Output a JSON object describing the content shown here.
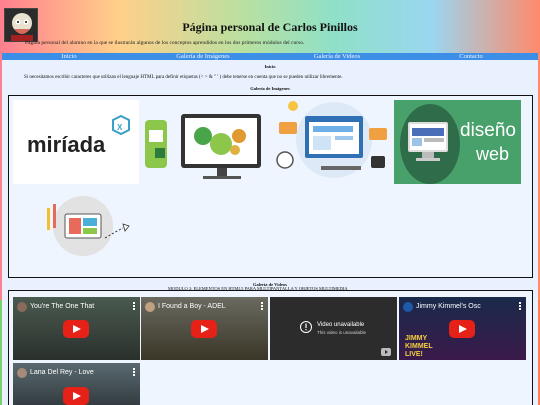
{
  "header": {
    "title": "Página personal de Carlos Pinillos",
    "intro": "Página personal del alumno en la que se ilustrarán algunos de los conceptos aprendidos en los dos primeros módulos del curso."
  },
  "nav": [
    "Inicio",
    "Galería de Imágenes",
    "Galería de Videos",
    "Contacto"
  ],
  "inicio": {
    "title": "Inicio",
    "text": "Si necesitamos escribir caracteres que utilizan el lenguaje HTML para definir etiquetas (< > & \"  ' ) debe tenerse en cuenta que no se pueden utilizar libremente."
  },
  "gallery_images": {
    "title": "Galería de Imágenes",
    "logo_miriada": "miríada",
    "logo_diseno": "diseño",
    "logo_web": "web"
  },
  "gallery_videos": {
    "title": "Galería de Videos",
    "overlay": "MODULO 2: ELEMENTOS EN HTML5 PARA MULTIPANTALLA Y OBJETOS MULTIMEDIA",
    "videos": [
      {
        "title": "You're The One That"
      },
      {
        "title": "I Found a Boy - ADEL"
      },
      {
        "title": "",
        "unavailable": "Video unavailable",
        "unavailable_sub": "This video is unavailable"
      },
      {
        "title": "Jimmy Kimmel's Osc"
      },
      {
        "title": "Lana Del Rey - Love"
      }
    ],
    "jimmy_caption": "JIMMY KIMMEL LIVE!"
  },
  "colors": {
    "nav": "#3d8ee6",
    "content": "#e8f1fd",
    "youtube": "#e62117",
    "diseno_green": "#48a06a"
  }
}
